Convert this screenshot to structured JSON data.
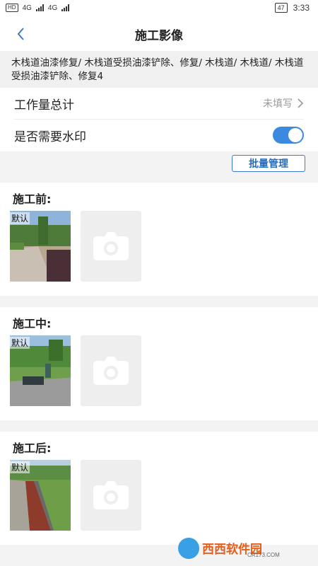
{
  "status_bar": {
    "left_labels": [
      "HD",
      "4G",
      "4G"
    ],
    "battery": "47",
    "time": "3:33"
  },
  "header": {
    "title": "施工影像",
    "back_icon": "chevron-left-icon"
  },
  "description": "木栈道油漆修复/ 木栈道受损油漆铲除、修复/ 木栈道/ 木栈道/ 木栈道受损油漆铲除、修复4",
  "workload": {
    "label": "工作量总计",
    "value": "未填写"
  },
  "watermark_row": {
    "label": "是否需要水印",
    "enabled": true
  },
  "batch_button": "批量管理",
  "sections": [
    {
      "title": "施工前:",
      "photo_tag": "默认"
    },
    {
      "title": "施工中:",
      "photo_tag": "默认"
    },
    {
      "title": "施工后:",
      "photo_tag": "默认"
    }
  ],
  "overlay_logo": {
    "brand": "西西软件园",
    "site": "CR173.COM"
  },
  "colors": {
    "accent": "#3b8ae0",
    "background": "#f3f3f3"
  }
}
